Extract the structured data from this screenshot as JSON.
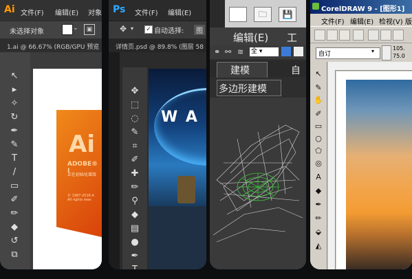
{
  "illustrator": {
    "logo": "Ai",
    "menu": [
      "文件(F)",
      "编辑(E)",
      "对象"
    ],
    "control_label": "未选择对象",
    "tab_title": "1.ai @ 66.67% (RGB/GPU 预览",
    "splash": {
      "big": "Ai",
      "brand": "ADOBE® I",
      "loading": "正在初始化增效",
      "copyright": "© 1987-2016 A\nAll rights rese"
    }
  },
  "photoshop": {
    "logo": "Ps",
    "menu": [
      "文件(F)",
      "编辑(E)"
    ],
    "auto_select_label": "自动选择:",
    "auto_select_value": "图",
    "tab_title": "详情页.psd @ 89.8% (图层 58",
    "canvas_text": "W A"
  },
  "max3d": {
    "menu": [
      "编辑(E)",
      "工具"
    ],
    "tabs": [
      "建模",
      "自"
    ],
    "subtab": "多边形建模",
    "filter": "全"
  },
  "coreldraw": {
    "title": "CorelDRAW 9 - [图形1]",
    "menu": [
      "文件(F)",
      "编辑(E)",
      "检视(V)",
      "版"
    ],
    "preset": "自订",
    "size_w": "105.",
    "size_h": "75.0"
  },
  "colors": {
    "ai_orange": "#ff9a00",
    "ps_blue": "#31a8ff"
  }
}
